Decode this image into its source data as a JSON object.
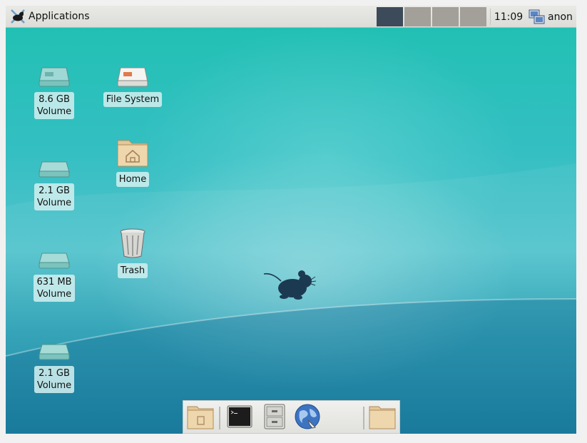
{
  "panel": {
    "applications_label": "Applications",
    "clock": "11:09",
    "user": "anon",
    "workspaces": [
      "1",
      "2",
      "3",
      "4"
    ]
  },
  "desktop_icons": [
    {
      "label_line1": "8.6 GB",
      "label_line2": "Volume",
      "icon": "drive-icon"
    },
    {
      "label_line1": "2.1 GB",
      "label_line2": "Volume",
      "icon": "drive-icon"
    },
    {
      "label_line1": "631 MB",
      "label_line2": "Volume",
      "icon": "drive-icon"
    },
    {
      "label_line1": "2.1 GB",
      "label_line2": "Volume",
      "icon": "drive-icon"
    },
    {
      "label_line1": "File System",
      "icon": "harddisk-icon"
    },
    {
      "label_line1": "Home",
      "icon": "home-folder-icon"
    },
    {
      "label_line1": "Trash",
      "icon": "trash-icon"
    }
  ],
  "dock": {
    "items": [
      "show-desktop-icon",
      "terminal-icon",
      "file-manager-icon",
      "web-browser-icon",
      "folder-icon"
    ]
  },
  "colors": {
    "panel_bg": "#e4e4e1",
    "workspace_active": "#3c4a59",
    "workspace_inactive": "#a39f99",
    "desktop_top": "#22c0b4",
    "desktop_bottom": "#0f7a9b"
  }
}
